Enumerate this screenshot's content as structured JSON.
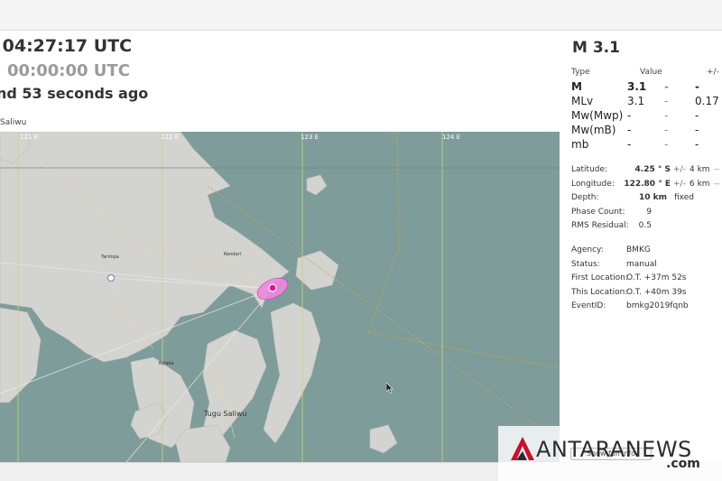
{
  "header": {
    "origin_time": "04:27:17 UTC",
    "reported_time": "00:00:00 UTC",
    "time_ago": "nd 53 seconds ago",
    "nearest_city": "Saliwu"
  },
  "map": {
    "grid_labels": [
      "121 E",
      "122 E",
      "123 E",
      "124 E"
    ],
    "place_labels": [
      "Tugu Saliwu",
      "Kendari",
      "Tarimpa",
      "Kolaka"
    ],
    "colors": {
      "sea": "#7e9c9a",
      "land": "#d3d3cf",
      "epicenter": "#e0149a",
      "epicenter_ring": "#ee88dd",
      "grid": "#c9d77a"
    }
  },
  "magnitude": {
    "title": "M 3.1",
    "headers": {
      "type": "Type",
      "value": "Value",
      "uncertainty": "+/-"
    },
    "rows": [
      {
        "type": "M",
        "value": "3.1",
        "dash": "-",
        "unc": "-",
        "bold": true
      },
      {
        "type": "MLv",
        "value": "3.1",
        "dash": "-",
        "unc": "0.17",
        "bold": false
      },
      {
        "type": "Mw(Mwp)",
        "value": "-",
        "dash": "-",
        "unc": "-",
        "bold": false
      },
      {
        "type": "Mw(mB)",
        "value": "-",
        "dash": "-",
        "unc": "-",
        "bold": false
      },
      {
        "type": "mb",
        "value": "-",
        "dash": "-",
        "unc": "-",
        "bold": false
      }
    ]
  },
  "location": {
    "latitude": {
      "label": "Latitude:",
      "value": "4.25 ° S",
      "pm": "+/-",
      "unc": "4 km",
      "extra": "--"
    },
    "longitude": {
      "label": "Longitude:",
      "value": "122.80 ° E",
      "pm": "+/-",
      "unc": "6 km",
      "extra": "--"
    },
    "depth": {
      "label": "Depth:",
      "value": "10 km",
      "pm": "fixed"
    },
    "phase_count": {
      "label": "Phase Count:",
      "value": "9"
    },
    "rms_residual": {
      "label": "RMS Residual:",
      "value": "0.5"
    }
  },
  "origin": {
    "agency": {
      "label": "Agency:",
      "value": "BMKG"
    },
    "status": {
      "label": "Status:",
      "value": "manual"
    },
    "first_location": {
      "label": "First Location:",
      "value": "O.T. +37m 52s"
    },
    "this_location": {
      "label": "This Location:",
      "value": "O.T. +40m 39s"
    },
    "event_id": {
      "label": "EventID:",
      "value": "bmkg2019fqnb"
    }
  },
  "watermark": {
    "text": "ANTARANEWS",
    "suffix": ".com",
    "button_label": "Show full info"
  }
}
